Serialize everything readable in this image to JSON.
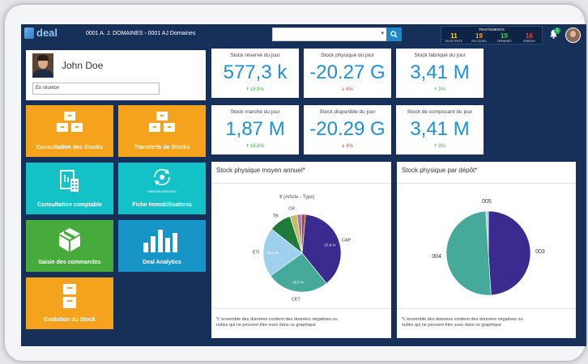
{
  "header": {
    "logo_text": "deal",
    "company": "0001 A. J. DOMAINES - 0001 AJ Domaines",
    "search_value": "",
    "notification_count": "1"
  },
  "traitements": {
    "title": "TRAITEMENTS",
    "items": [
      {
        "value": "11",
        "label": "EN ATTENTE",
        "color": "#ffd400"
      },
      {
        "value": "19",
        "label": "EN COURS",
        "color": "#ffa31a"
      },
      {
        "value": "19",
        "label": "TERMINÉS",
        "color": "#3fd14a"
      },
      {
        "value": "16",
        "label": "ERREUR",
        "color": "#ff3b30"
      }
    ]
  },
  "profile": {
    "name": "John Doe",
    "status": "En réunion"
  },
  "tiles": {
    "consultation_stocks": "Consultation des Stocks",
    "transferts_stocks": "Transferts de Stocks",
    "consultation_comptable": "Consultation comptable",
    "fiche_immobilisations": "Fiche Immobilisations",
    "immobilisations_caption": "IMMOBILISATIONS",
    "saisie_commandes": "Saisie des commandes",
    "deal_analytics": "Deal Analytics",
    "evolution_stock": "Evolution du Stock"
  },
  "kpis": [
    {
      "title": "Stock réservé du jour",
      "value": "577,3 k",
      "delta": "16,8%",
      "trend": "up"
    },
    {
      "title": "Stock physique du jour",
      "value": "-20.27 G",
      "delta": "4%",
      "trend": "down"
    },
    {
      "title": "Stock fabriqué du jour",
      "value": "3,41 M",
      "delta": "3%",
      "trend": "up"
    },
    {
      "title": "Stock marché du jour",
      "value": "1,87 M",
      "delta": "16,8%",
      "trend": "up"
    },
    {
      "title": "Stock disponible du jour",
      "value": "-20.29 G",
      "delta": "4%",
      "trend": "down"
    },
    {
      "title": "Stock de composant du jour",
      "value": "3,41 M",
      "delta": "3%",
      "trend": "up"
    }
  ],
  "cards": {
    "pie1_title": "Stock physique moyen annuel*",
    "pie1_legend": "[Article - Type]",
    "pie2_title": "Stock physique par dépôt*",
    "note_line1": "*L'ensemble des données contient des données négatives ou",
    "note_line2": "nulles qui ne peuvent être vues dans ce graphique"
  },
  "chart_data": [
    {
      "type": "pie",
      "title": "Stock physique moyen annuel*",
      "legend_title": "[Article - Type]",
      "slices": [
        {
          "label": "CAP",
          "value": 37.8,
          "value_label": "37.8 %",
          "color": "#3b2b8f"
        },
        {
          "label": "CET",
          "value": 25.9,
          "value_label": "25.9 %",
          "color": "#45aa9a"
        },
        {
          "label": "ETI",
          "value": 20.6,
          "value_label": "20.6 %",
          "color": "#9fd0ee"
        },
        {
          "label": "TB",
          "value": 9.2,
          "value_label": "",
          "color": "#1f7a3a"
        },
        {
          "label": "CR",
          "value": 3.0,
          "value_label": "",
          "color": "#c8bc6a"
        },
        {
          "label": "",
          "value": 1.8,
          "value_label": "",
          "color": "#a07ab8"
        },
        {
          "label": "",
          "value": 1.7,
          "value_label": "",
          "color": "#b4453a"
        }
      ]
    },
    {
      "type": "pie",
      "title": "Stock physique par dépôt*",
      "slices": [
        {
          "label": "003",
          "value": 49.0,
          "color": "#3b2b8f"
        },
        {
          "label": "004",
          "value": 50.0,
          "color": "#45aa9a"
        },
        {
          "label": "005",
          "value": 1.0,
          "color": "#9fd0ee"
        }
      ]
    }
  ]
}
